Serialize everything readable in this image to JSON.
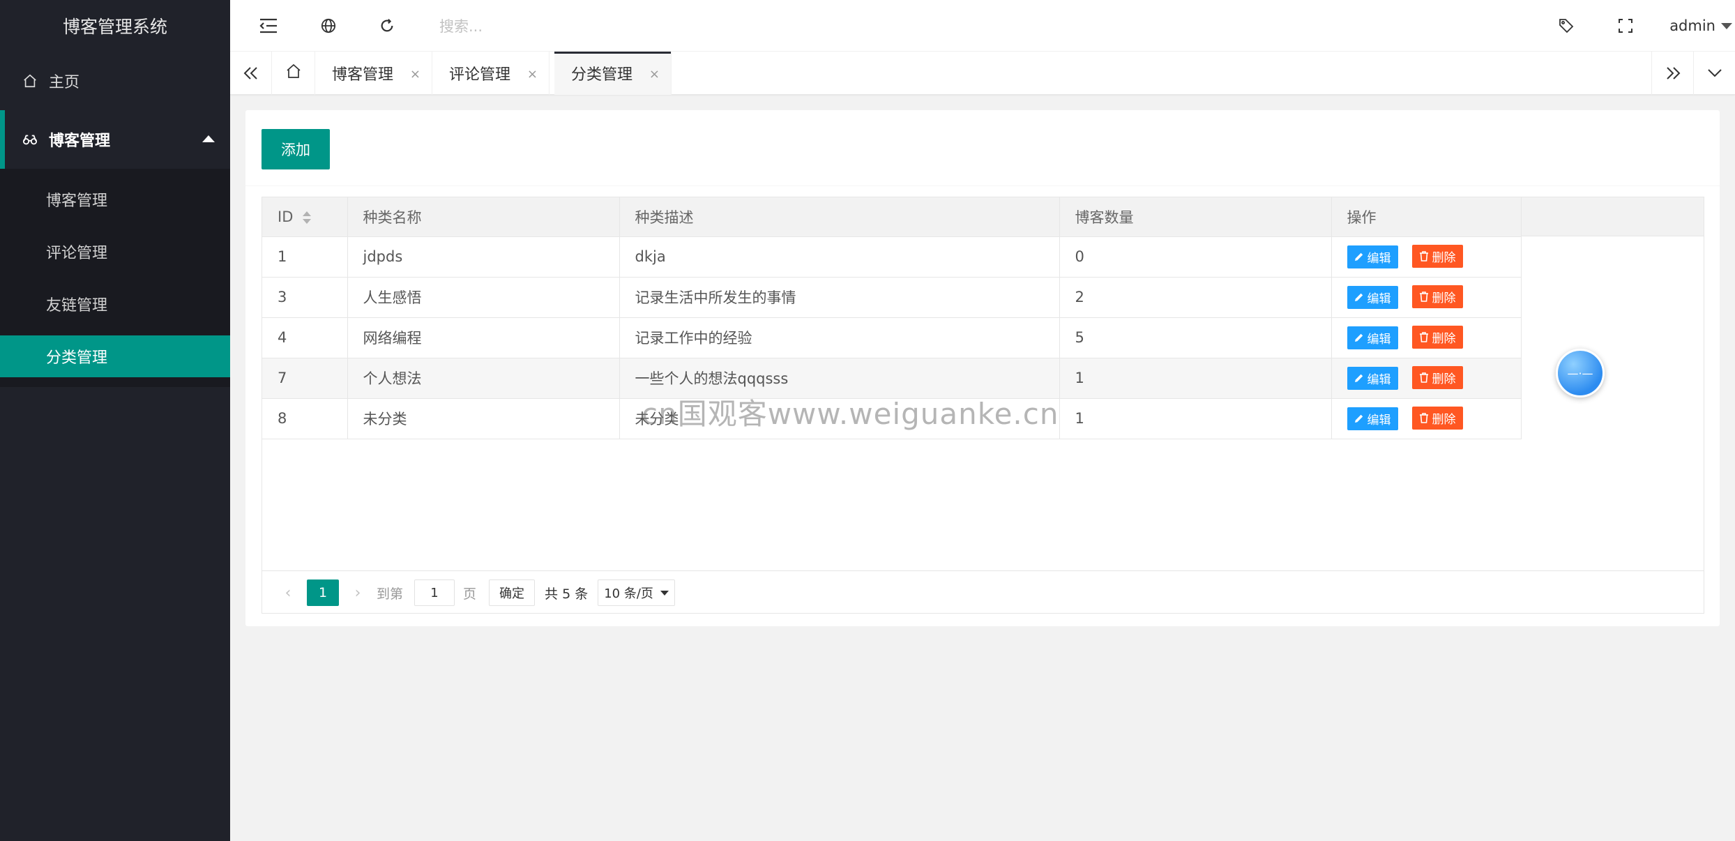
{
  "app": {
    "title": "博客管理系统"
  },
  "sidebar": {
    "home_label": "主页",
    "group_label": "博客管理",
    "sub_items": [
      {
        "label": "博客管理",
        "active": false
      },
      {
        "label": "评论管理",
        "active": false
      },
      {
        "label": "友链管理",
        "active": false
      },
      {
        "label": "分类管理",
        "active": true
      }
    ]
  },
  "header": {
    "search_placeholder": "搜索...",
    "user": "admin",
    "icons": [
      "menu-fold-icon",
      "globe-icon",
      "refresh-icon",
      "tag-icon",
      "fullscreen-icon"
    ]
  },
  "tabs": {
    "items": [
      {
        "label": "博客管理",
        "close": "×",
        "active": false
      },
      {
        "label": "评论管理",
        "close": "×",
        "active": false
      },
      {
        "label": "分类管理",
        "close": "×",
        "active": true
      }
    ]
  },
  "main": {
    "add_label": "添加",
    "columns": [
      "ID",
      "种类名称",
      "种类描述",
      "博客数量",
      "操作"
    ],
    "rows": [
      {
        "id": "1",
        "name": "jdpds",
        "desc": "dkja",
        "count": "0"
      },
      {
        "id": "3",
        "name": "人生感悟",
        "desc": "记录生活中所发生的事情",
        "count": "2"
      },
      {
        "id": "4",
        "name": "网络编程",
        "desc": "记录工作中的经验",
        "count": "5"
      },
      {
        "id": "7",
        "name": "个人想法",
        "desc": "一些个人的想法qqqsss",
        "count": "1"
      },
      {
        "id": "8",
        "name": "未分类",
        "desc": "未分类",
        "count": "1"
      }
    ],
    "edit_label": "编辑",
    "delete_label": "删除"
  },
  "pagination": {
    "current_page": "1",
    "skip_label": "到第",
    "skip_value": "1",
    "page_unit": "页",
    "confirm_label": "确定",
    "total_label": "共 5 条",
    "page_size": "10 条/页"
  },
  "watermark": "cn国观客www.weiguanke.cn",
  "float_ball_text": "—·—",
  "colors": {
    "primary": "#009688",
    "edit": "#1e9fff",
    "delete": "#ff5722",
    "sidebar": "#20222a"
  }
}
